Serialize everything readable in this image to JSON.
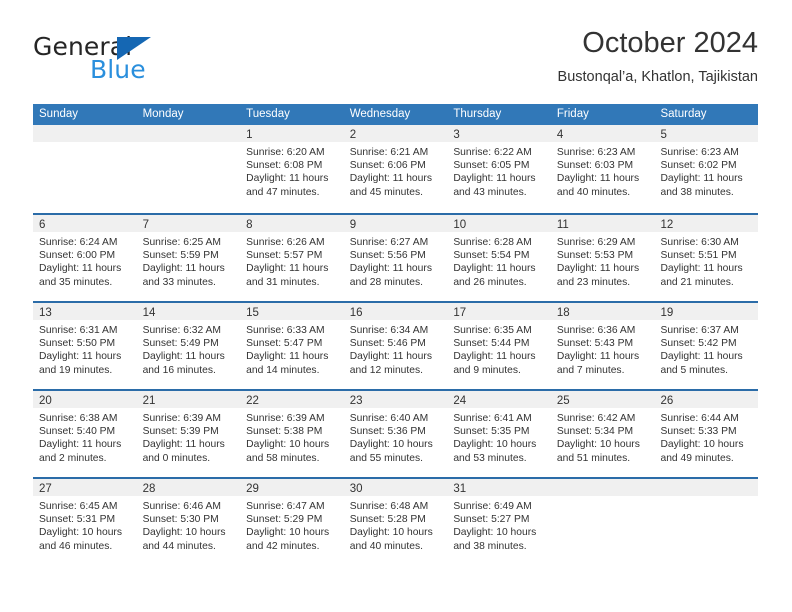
{
  "brand": {
    "name_top": "General",
    "name_bottom": "Blue",
    "accent_color": "#2a8fdd",
    "triangle_color": "#1567b3"
  },
  "header": {
    "month_title": "October 2024",
    "location": "Bustonqal’a, Khatlon, Tajikistan"
  },
  "calendar": {
    "header_bg": "#3178b8",
    "weekday_headers": [
      "Sunday",
      "Monday",
      "Tuesday",
      "Wednesday",
      "Thursday",
      "Friday",
      "Saturday"
    ],
    "weeks": [
      [
        {
          "day": "",
          "sunrise": "",
          "sunset": "",
          "daylight_line1": "",
          "daylight_line2": ""
        },
        {
          "day": "",
          "sunrise": "",
          "sunset": "",
          "daylight_line1": "",
          "daylight_line2": ""
        },
        {
          "day": "1",
          "sunrise": "Sunrise: 6:20 AM",
          "sunset": "Sunset: 6:08 PM",
          "daylight_line1": "Daylight: 11 hours",
          "daylight_line2": "and 47 minutes."
        },
        {
          "day": "2",
          "sunrise": "Sunrise: 6:21 AM",
          "sunset": "Sunset: 6:06 PM",
          "daylight_line1": "Daylight: 11 hours",
          "daylight_line2": "and 45 minutes."
        },
        {
          "day": "3",
          "sunrise": "Sunrise: 6:22 AM",
          "sunset": "Sunset: 6:05 PM",
          "daylight_line1": "Daylight: 11 hours",
          "daylight_line2": "and 43 minutes."
        },
        {
          "day": "4",
          "sunrise": "Sunrise: 6:23 AM",
          "sunset": "Sunset: 6:03 PM",
          "daylight_line1": "Daylight: 11 hours",
          "daylight_line2": "and 40 minutes."
        },
        {
          "day": "5",
          "sunrise": "Sunrise: 6:23 AM",
          "sunset": "Sunset: 6:02 PM",
          "daylight_line1": "Daylight: 11 hours",
          "daylight_line2": "and 38 minutes."
        }
      ],
      [
        {
          "day": "6",
          "sunrise": "Sunrise: 6:24 AM",
          "sunset": "Sunset: 6:00 PM",
          "daylight_line1": "Daylight: 11 hours",
          "daylight_line2": "and 35 minutes."
        },
        {
          "day": "7",
          "sunrise": "Sunrise: 6:25 AM",
          "sunset": "Sunset: 5:59 PM",
          "daylight_line1": "Daylight: 11 hours",
          "daylight_line2": "and 33 minutes."
        },
        {
          "day": "8",
          "sunrise": "Sunrise: 6:26 AM",
          "sunset": "Sunset: 5:57 PM",
          "daylight_line1": "Daylight: 11 hours",
          "daylight_line2": "and 31 minutes."
        },
        {
          "day": "9",
          "sunrise": "Sunrise: 6:27 AM",
          "sunset": "Sunset: 5:56 PM",
          "daylight_line1": "Daylight: 11 hours",
          "daylight_line2": "and 28 minutes."
        },
        {
          "day": "10",
          "sunrise": "Sunrise: 6:28 AM",
          "sunset": "Sunset: 5:54 PM",
          "daylight_line1": "Daylight: 11 hours",
          "daylight_line2": "and 26 minutes."
        },
        {
          "day": "11",
          "sunrise": "Sunrise: 6:29 AM",
          "sunset": "Sunset: 5:53 PM",
          "daylight_line1": "Daylight: 11 hours",
          "daylight_line2": "and 23 minutes."
        },
        {
          "day": "12",
          "sunrise": "Sunrise: 6:30 AM",
          "sunset": "Sunset: 5:51 PM",
          "daylight_line1": "Daylight: 11 hours",
          "daylight_line2": "and 21 minutes."
        }
      ],
      [
        {
          "day": "13",
          "sunrise": "Sunrise: 6:31 AM",
          "sunset": "Sunset: 5:50 PM",
          "daylight_line1": "Daylight: 11 hours",
          "daylight_line2": "and 19 minutes."
        },
        {
          "day": "14",
          "sunrise": "Sunrise: 6:32 AM",
          "sunset": "Sunset: 5:49 PM",
          "daylight_line1": "Daylight: 11 hours",
          "daylight_line2": "and 16 minutes."
        },
        {
          "day": "15",
          "sunrise": "Sunrise: 6:33 AM",
          "sunset": "Sunset: 5:47 PM",
          "daylight_line1": "Daylight: 11 hours",
          "daylight_line2": "and 14 minutes."
        },
        {
          "day": "16",
          "sunrise": "Sunrise: 6:34 AM",
          "sunset": "Sunset: 5:46 PM",
          "daylight_line1": "Daylight: 11 hours",
          "daylight_line2": "and 12 minutes."
        },
        {
          "day": "17",
          "sunrise": "Sunrise: 6:35 AM",
          "sunset": "Sunset: 5:44 PM",
          "daylight_line1": "Daylight: 11 hours",
          "daylight_line2": "and 9 minutes."
        },
        {
          "day": "18",
          "sunrise": "Sunrise: 6:36 AM",
          "sunset": "Sunset: 5:43 PM",
          "daylight_line1": "Daylight: 11 hours",
          "daylight_line2": "and 7 minutes."
        },
        {
          "day": "19",
          "sunrise": "Sunrise: 6:37 AM",
          "sunset": "Sunset: 5:42 PM",
          "daylight_line1": "Daylight: 11 hours",
          "daylight_line2": "and 5 minutes."
        }
      ],
      [
        {
          "day": "20",
          "sunrise": "Sunrise: 6:38 AM",
          "sunset": "Sunset: 5:40 PM",
          "daylight_line1": "Daylight: 11 hours",
          "daylight_line2": "and 2 minutes."
        },
        {
          "day": "21",
          "sunrise": "Sunrise: 6:39 AM",
          "sunset": "Sunset: 5:39 PM",
          "daylight_line1": "Daylight: 11 hours",
          "daylight_line2": "and 0 minutes."
        },
        {
          "day": "22",
          "sunrise": "Sunrise: 6:39 AM",
          "sunset": "Sunset: 5:38 PM",
          "daylight_line1": "Daylight: 10 hours",
          "daylight_line2": "and 58 minutes."
        },
        {
          "day": "23",
          "sunrise": "Sunrise: 6:40 AM",
          "sunset": "Sunset: 5:36 PM",
          "daylight_line1": "Daylight: 10 hours",
          "daylight_line2": "and 55 minutes."
        },
        {
          "day": "24",
          "sunrise": "Sunrise: 6:41 AM",
          "sunset": "Sunset: 5:35 PM",
          "daylight_line1": "Daylight: 10 hours",
          "daylight_line2": "and 53 minutes."
        },
        {
          "day": "25",
          "sunrise": "Sunrise: 6:42 AM",
          "sunset": "Sunset: 5:34 PM",
          "daylight_line1": "Daylight: 10 hours",
          "daylight_line2": "and 51 minutes."
        },
        {
          "day": "26",
          "sunrise": "Sunrise: 6:44 AM",
          "sunset": "Sunset: 5:33 PM",
          "daylight_line1": "Daylight: 10 hours",
          "daylight_line2": "and 49 minutes."
        }
      ],
      [
        {
          "day": "27",
          "sunrise": "Sunrise: 6:45 AM",
          "sunset": "Sunset: 5:31 PM",
          "daylight_line1": "Daylight: 10 hours",
          "daylight_line2": "and 46 minutes."
        },
        {
          "day": "28",
          "sunrise": "Sunrise: 6:46 AM",
          "sunset": "Sunset: 5:30 PM",
          "daylight_line1": "Daylight: 10 hours",
          "daylight_line2": "and 44 minutes."
        },
        {
          "day": "29",
          "sunrise": "Sunrise: 6:47 AM",
          "sunset": "Sunset: 5:29 PM",
          "daylight_line1": "Daylight: 10 hours",
          "daylight_line2": "and 42 minutes."
        },
        {
          "day": "30",
          "sunrise": "Sunrise: 6:48 AM",
          "sunset": "Sunset: 5:28 PM",
          "daylight_line1": "Daylight: 10 hours",
          "daylight_line2": "and 40 minutes."
        },
        {
          "day": "31",
          "sunrise": "Sunrise: 6:49 AM",
          "sunset": "Sunset: 5:27 PM",
          "daylight_line1": "Daylight: 10 hours",
          "daylight_line2": "and 38 minutes."
        },
        {
          "day": "",
          "sunrise": "",
          "sunset": "",
          "daylight_line1": "",
          "daylight_line2": ""
        },
        {
          "day": "",
          "sunrise": "",
          "sunset": "",
          "daylight_line1": "",
          "daylight_line2": ""
        }
      ]
    ]
  }
}
